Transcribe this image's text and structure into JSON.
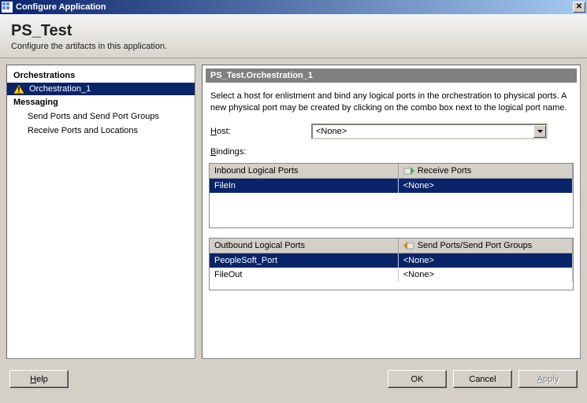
{
  "window": {
    "title": "Configure Application"
  },
  "header": {
    "title": "PS_Test",
    "subtitle": "Configure the artifacts in this application."
  },
  "nav": {
    "orchestrations_label": "Orchestrations",
    "messaging_label": "Messaging",
    "orchestrations": [
      {
        "label": "Orchestration_1",
        "has_warning": true,
        "selected": true
      }
    ],
    "messaging_items": [
      {
        "label": "Send Ports and Send Port Groups"
      },
      {
        "label": "Receive Ports and Locations"
      }
    ]
  },
  "content": {
    "title": "PS_Test.Orchestration_1",
    "instructions": "Select a host for enlistment and bind any logical ports in the orchestration to physical ports. A new physical port may be created by clicking on the combo box next to the logical port name.",
    "host_label_pre": "H",
    "host_label_post": "ost:",
    "host_value": "<None>",
    "bindings_label_pre": "B",
    "bindings_label_post": "indings:",
    "inbound": {
      "col_a": "Inbound Logical Ports",
      "col_b": "Receive Ports",
      "rows": [
        {
          "port": "FileIn",
          "value": "<None>",
          "selected": true
        }
      ]
    },
    "outbound": {
      "col_a": "Outbound Logical Ports",
      "col_b": "Send Ports/Send Port Groups",
      "rows": [
        {
          "port": "PeopleSoft_Port",
          "value": "<None>",
          "selected": true
        },
        {
          "port": "FileOut",
          "value": "<None>",
          "selected": false
        }
      ]
    }
  },
  "buttons": {
    "help_pre": "H",
    "help_post": "elp",
    "ok": "OK",
    "cancel": "Cancel",
    "apply_pre": "A",
    "apply_post": "pply"
  }
}
